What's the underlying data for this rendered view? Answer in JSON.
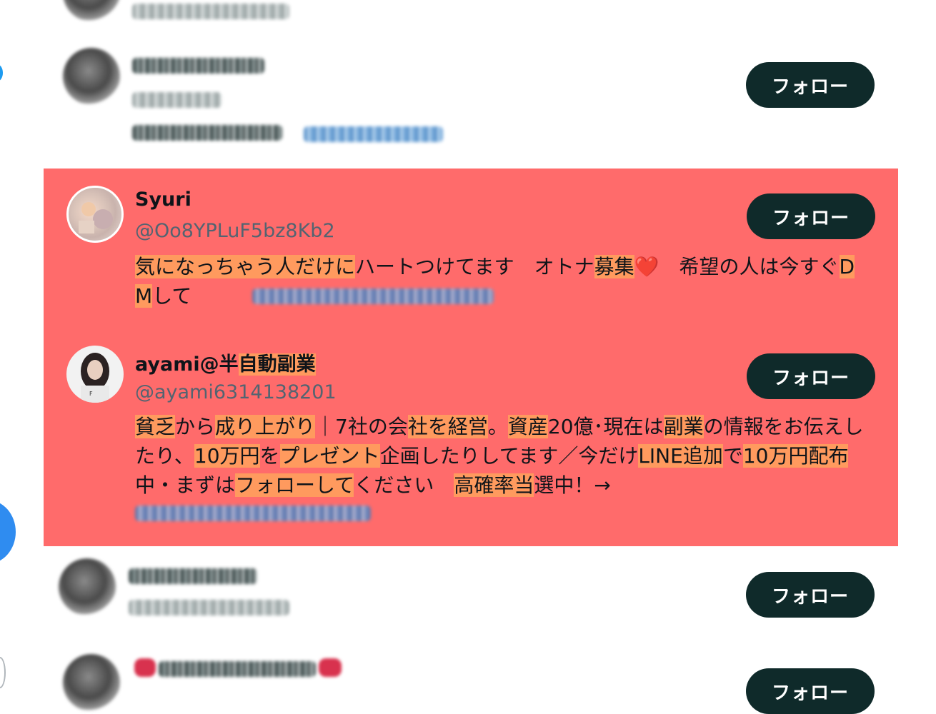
{
  "follow_label": "フォロー",
  "users": [
    {
      "name": "Syuri",
      "handle": "@Oo8YPLuF5bz8Kb2",
      "bio_parts": [
        {
          "t": "気になっちゃう人だけに",
          "h": true
        },
        {
          "t": "ハートつけてます　オトナ",
          "h": false
        },
        {
          "t": "募集",
          "h": true
        },
        {
          "t": "❤️",
          "h": false
        },
        {
          "t": "　希望の人は今すぐ",
          "h": false
        },
        {
          "t": "DM",
          "h": true
        },
        {
          "t": "して",
          "h": false
        }
      ]
    },
    {
      "name_plain": "ayami@半",
      "name_hl": "自動副業",
      "handle": "@ayami6314138201",
      "bio_parts": [
        {
          "t": "貧乏",
          "h": true
        },
        {
          "t": "から",
          "h": false
        },
        {
          "t": "成り上がり",
          "h": true
        },
        {
          "t": "｜7社の会",
          "h": false
        },
        {
          "t": "社を経営",
          "h": true
        },
        {
          "t": "。",
          "h": false
        },
        {
          "t": "資産",
          "h": true
        },
        {
          "t": "20億･現在は",
          "h": false
        },
        {
          "t": "副業",
          "h": true
        },
        {
          "t": "の情報をお伝えしたり、",
          "h": false
        },
        {
          "t": "10万円",
          "h": true
        },
        {
          "t": "を",
          "h": false
        },
        {
          "t": "プレゼント",
          "h": true
        },
        {
          "t": "企画したりしてます／今だけ",
          "h": false
        },
        {
          "t": "LINE追加",
          "h": true
        },
        {
          "t": "で",
          "h": false
        },
        {
          "t": "10万円配布",
          "h": true
        },
        {
          "t": "中・まずは",
          "h": false
        },
        {
          "t": "フォローして",
          "h": true
        },
        {
          "t": "ください　",
          "h": false
        },
        {
          "t": "高確率当",
          "h": true
        },
        {
          "t": "選中！→",
          "h": false
        }
      ]
    }
  ],
  "colors": {
    "highlight_bg": "#ff6b6b",
    "text_highlight": "#ff9a5e",
    "follow_bg": "#0f2a2a",
    "handle": "#536471"
  }
}
